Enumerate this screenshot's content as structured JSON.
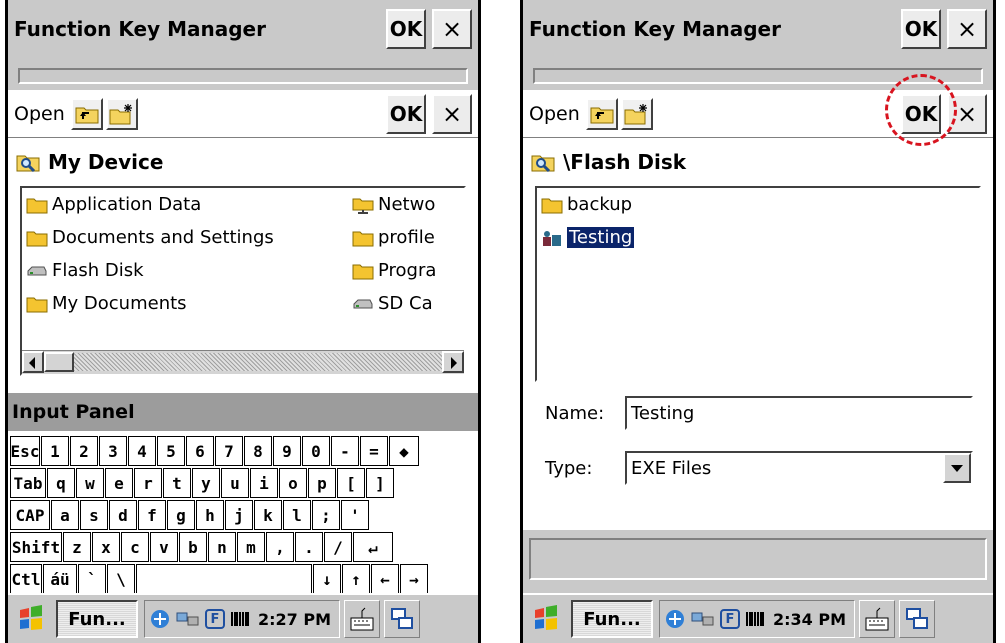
{
  "left": {
    "window_title": "Function Key Manager",
    "ok_label": "OK",
    "close_label": "×",
    "dialog": {
      "title": "Open",
      "ok_label": "OK",
      "close_label": "×",
      "path": "My Device",
      "items": [
        {
          "label": "Application Data",
          "icon": "folder-icon"
        },
        {
          "label": "Documents and Settings",
          "icon": "folder-icon"
        },
        {
          "label": "Flash Disk",
          "icon": "drive-icon"
        },
        {
          "label": "My Documents",
          "icon": "folder-icon"
        },
        {
          "label": "Netwo",
          "icon": "network-folder-icon"
        },
        {
          "label": "profile",
          "icon": "folder-icon"
        },
        {
          "label": "Progra",
          "icon": "folder-icon"
        },
        {
          "label": "SD Ca",
          "icon": "drive-icon"
        }
      ]
    },
    "input_panel": {
      "title": "Input Panel",
      "rows": [
        [
          "Esc",
          "1",
          "2",
          "3",
          "4",
          "5",
          "6",
          "7",
          "8",
          "9",
          "0",
          "-",
          "=",
          "◆"
        ],
        [
          "Tab",
          "q",
          "w",
          "e",
          "r",
          "t",
          "y",
          "u",
          "i",
          "o",
          "p",
          "[",
          "]"
        ],
        [
          "CAP",
          "a",
          "s",
          "d",
          "f",
          "g",
          "h",
          "j",
          "k",
          "l",
          ";",
          "'"
        ],
        [
          "Shift",
          "z",
          "x",
          "c",
          "v",
          "b",
          "n",
          "m",
          ",",
          ".",
          "/",
          "↵"
        ],
        [
          "Ctl",
          "áü",
          "`",
          "\\",
          "",
          "↓",
          "↑",
          "←",
          "→"
        ]
      ]
    },
    "taskbar": {
      "task_label": "Fun...",
      "clock": "2:27 PM",
      "f_label": "F"
    }
  },
  "right": {
    "window_title": "Function Key Manager",
    "ok_label": "OK",
    "close_label": "×",
    "dialog": {
      "title": "Open",
      "ok_label": "OK",
      "close_label": "×",
      "path": "\\Flash Disk",
      "items": [
        {
          "label": "backup",
          "icon": "folder-icon"
        },
        {
          "label": "Testing",
          "icon": "program-icon",
          "selected": true
        }
      ],
      "name_label": "Name:",
      "name_value": "Testing",
      "type_label": "Type:",
      "type_value": "EXE Files"
    },
    "taskbar": {
      "task_label": "Fun...",
      "clock": "2:34 PM",
      "f_label": "F"
    },
    "highlight_color": "#d8141f"
  }
}
